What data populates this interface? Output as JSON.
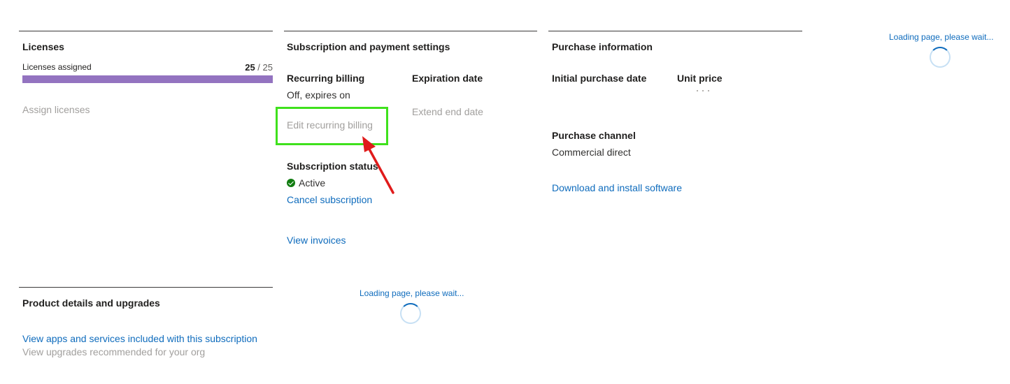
{
  "licenses": {
    "title": "Licenses",
    "assigned_label": "Licenses assigned",
    "assigned": "25",
    "separator": " / ",
    "total": "25",
    "fill_fraction": 1.0,
    "assign_label": "Assign licenses"
  },
  "subscription": {
    "title": "Subscription and payment settings",
    "recurring_label": "Recurring billing",
    "recurring_value": "Off, expires on",
    "edit_recurring": "Edit recurring billing",
    "expiration_label": "Expiration date",
    "extend_end": "Extend end date",
    "status_label": "Subscription status",
    "status_value": "Active",
    "cancel": "Cancel subscription",
    "view_invoices": "View invoices"
  },
  "purchase": {
    "title": "Purchase information",
    "initial_date_label": "Initial purchase date",
    "unit_price_label": "Unit price",
    "channel_label": "Purchase channel",
    "channel_value": "Commercial direct",
    "download": "Download and install software"
  },
  "product": {
    "title": "Product details and upgrades",
    "view_apps": "View apps and services included with this subscription",
    "view_upgrades": "View upgrades recommended for your org"
  },
  "loading": {
    "text": "Loading page, please wait..."
  },
  "colors": {
    "accent": "#0f6cbd",
    "progress": "#9373c0",
    "highlight": "#3fe11d",
    "arrow": "#e01b1b",
    "success": "#107c10"
  },
  "icons": {
    "status": "check-circle-icon",
    "spinner": "loading-spinner-icon",
    "annotation": "red-arrow-icon"
  }
}
